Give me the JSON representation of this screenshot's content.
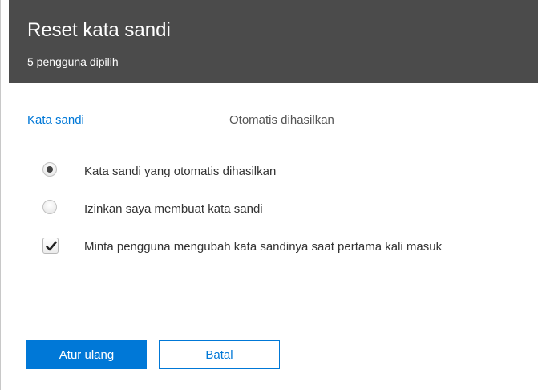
{
  "header": {
    "title": "Reset kata sandi",
    "subtitle": "5 pengguna dipilih"
  },
  "password_field": {
    "label": "Kata sandi",
    "value": "Otomatis dihasilkan"
  },
  "options": {
    "auto_generate": {
      "label": "Kata sandi yang otomatis dihasilkan",
      "selected": true
    },
    "let_me_create": {
      "label": "Izinkan saya membuat kata sandi",
      "selected": false
    },
    "require_change": {
      "label": "Minta pengguna mengubah kata sandinya saat pertama kali masuk",
      "checked": true
    }
  },
  "buttons": {
    "reset_label": "Atur ulang",
    "cancel_label": "Batal"
  },
  "colors": {
    "header_bg": "#4b4b4b",
    "accent": "#0078d7"
  },
  "icons": {
    "checkmark": "checkmark-icon"
  }
}
